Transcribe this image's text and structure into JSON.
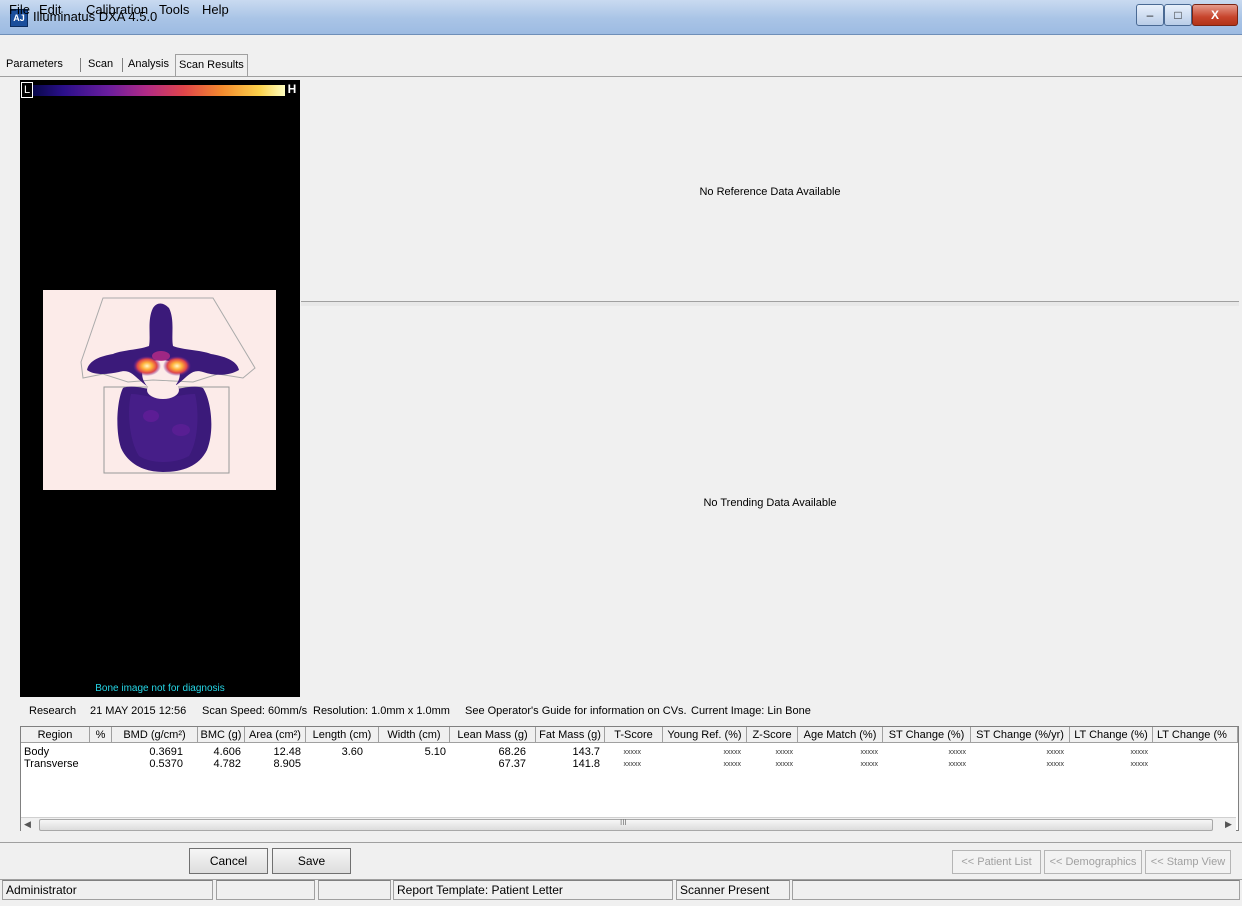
{
  "window": {
    "title": "Illuminatus DXA 4.5.0",
    "app_icon_text": "AJ",
    "minimize_glyph": "‒",
    "maximize_glyph": "□",
    "close_glyph": "X"
  },
  "menu": [
    "File",
    "Edit",
    "Calibration",
    "Tools",
    "Help"
  ],
  "tabs": [
    "Parameters",
    "Scan",
    "Analysis",
    "Scan Results"
  ],
  "active_tab": "Scan Results",
  "image_panel": {
    "low_label": "L",
    "high_label": "H",
    "caption": "Bone image not for diagnosis"
  },
  "reference_panel": {
    "message": "No Reference Data Available"
  },
  "trending_panel": {
    "message": "No Trending Data Available"
  },
  "scan_info": {
    "category": "Research",
    "date_time": "21 MAY 2015  12:56",
    "scan_speed": "Scan Speed: 60mm/s",
    "resolution": "Resolution: 1.0mm x 1.0mm",
    "guide_note": "See Operator's Guide for information on CVs.",
    "current_image": "Current Image: Lin  Bone"
  },
  "results_table": {
    "columns": [
      "Region",
      "%",
      "BMD (g/cm²)",
      "BMC (g)",
      "Area (cm²)",
      "Length (cm)",
      "Width (cm)",
      "Lean Mass (g)",
      "Fat Mass (g)",
      "T-Score",
      "Young Ref. (%)",
      "Z-Score",
      "Age Match (%)",
      "ST Change (%)",
      "ST Change (%/yr)",
      "LT Change (%)",
      "LT Change (%"
    ],
    "rows": [
      {
        "region": "Body",
        "pct": "",
        "bmd": "0.3691",
        "bmc": "4.606",
        "area": "12.48",
        "length": "3.60",
        "width": "5.10",
        "lean": "68.26",
        "fat": "143.7",
        "t_score": "xxxxx",
        "young_ref": "xxxxx",
        "z_score": "xxxxx",
        "age_match": "xxxxx",
        "st_change": "xxxxx",
        "st_change_yr": "xxxxx",
        "lt_change": "xxxxx"
      },
      {
        "region": "Transverse",
        "pct": "",
        "bmd": "0.5370",
        "bmc": "4.782",
        "area": "8.905",
        "length": "",
        "width": "",
        "lean": "67.37",
        "fat": "141.8",
        "t_score": "xxxxx",
        "young_ref": "xxxxx",
        "z_score": "xxxxx",
        "age_match": "xxxxx",
        "st_change": "xxxxx",
        "st_change_yr": "xxxxx",
        "lt_change": "xxxxx"
      }
    ],
    "scroll_thumb_grip": "III"
  },
  "buttons": {
    "cancel": "Cancel",
    "save": "Save",
    "patient_list": "<< Patient List",
    "demographics": "<< Demographics",
    "stamp_view": "<< Stamp View"
  },
  "status_bar": {
    "user": "Administrator",
    "cell2": "",
    "cell3": "",
    "report_template": "Report Template: Patient Letter",
    "scanner": "Scanner Present"
  }
}
